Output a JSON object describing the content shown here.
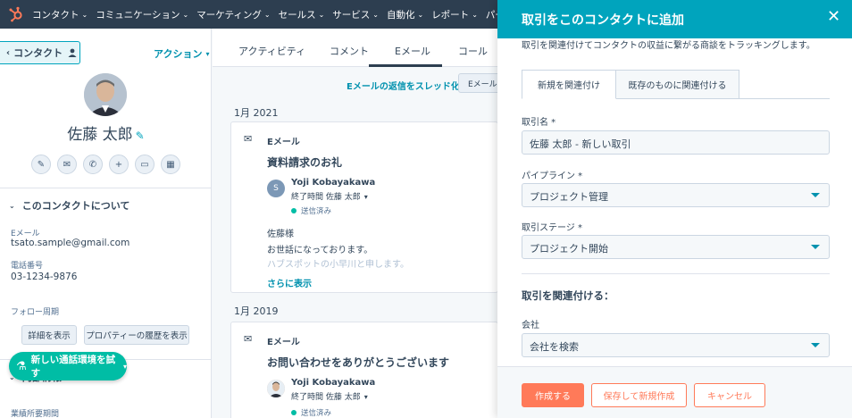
{
  "nav": {
    "items": [
      "コンタクト",
      "コミュニケーション",
      "マーケティング",
      "セールス",
      "サービス",
      "自動化",
      "レポート",
      "パートナー"
    ]
  },
  "left": {
    "back_label": "コンタクト",
    "actions_label": "アクション",
    "contact_name": "佐藤 太郎",
    "about_title": "このコンタクトについて",
    "email_label": "Eメール",
    "email_value": "tsato.sample@gmail.com",
    "phone_label": "電話番号",
    "phone_value": "03-1234-9876",
    "followup_label": "フォロー周期",
    "details_btn": "詳細を表示",
    "history_btn": "プロパティーの履歴を表示",
    "internal_title": "内部情報",
    "internal_sub": "業績所要期間",
    "call_btn": "新しい通話環境を試す"
  },
  "center": {
    "tabs": [
      "アクティビティ",
      "コメント",
      "Eメール",
      "コール"
    ],
    "thread_link": "Eメールの返信をスレッド化",
    "email_button": "Eメールの",
    "groups": [
      {
        "year": "1月 2021",
        "type": "Eメール",
        "subject": "資料請求のお礼",
        "avatar": "S",
        "from": "Yoji Kobayakawa",
        "to": "終了時間 佐藤 太郎",
        "status": "送信済み",
        "body1": "佐藤様",
        "body2": "お世話になっております。",
        "body3": "ハブスポットの小早川と申します。",
        "more": "さらに表示"
      },
      {
        "year": "1月 2019",
        "type": "Eメール",
        "subject": "お問い合わせをありがとうございます",
        "from": "Yoji Kobayakawa",
        "to": "終了時間 佐藤 太郎",
        "status": "送信済み"
      }
    ]
  },
  "panel": {
    "title": "取引をこのコンタクトに追加",
    "description": "取引を関連付けてコンタクトの収益に繋がる商談をトラッキングします。",
    "tab_new": "新規を関連付け",
    "tab_existing": "既存のものに関連付ける",
    "deal_name_label": "取引名 *",
    "deal_name_value": "佐藤 太郎 - 新しい取引",
    "pipeline_label": "パイプライン *",
    "pipeline_value": "プロジェクト管理",
    "stage_label": "取引ステージ *",
    "stage_value": "プロジェクト開始",
    "associate_title": "取引を関連付ける：",
    "company_label": "会社",
    "company_placeholder": "会社を検索",
    "create_btn": "作成する",
    "save_new_btn": "保存して新規作成",
    "cancel_btn": "キャンセル"
  },
  "colors": {
    "nav_bg": "#2d3e50",
    "accent": "#00a4bd",
    "primary": "#ff7a59",
    "success": "#00bda5",
    "link": "#0091ae"
  }
}
